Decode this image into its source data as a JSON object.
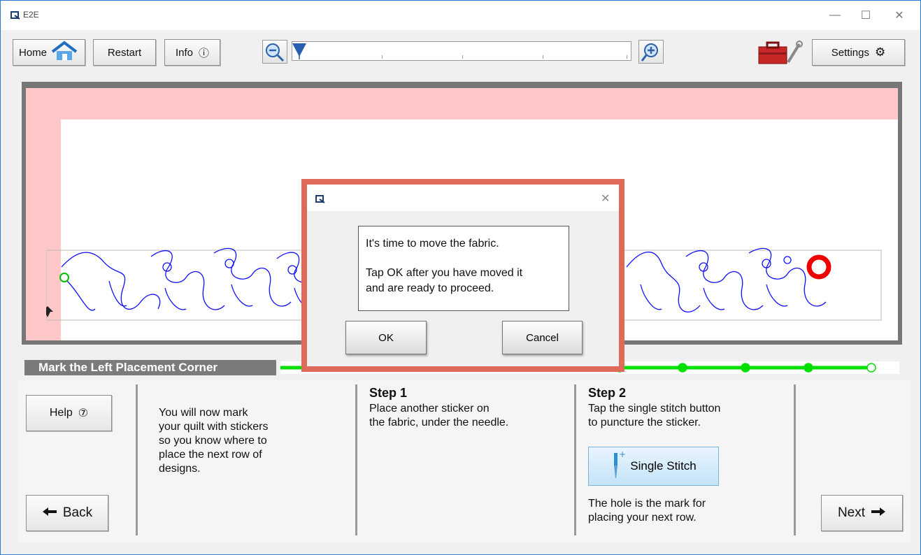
{
  "window": {
    "title": "E2E",
    "minimize": "—",
    "maximize": "☐",
    "close": "✕"
  },
  "toolbar": {
    "home_label": "Home",
    "restart_label": "Restart",
    "info_label": "Info",
    "info_icon": "ⓘ",
    "settings_label": "Settings",
    "settings_icon": "⚙"
  },
  "zoom": {
    "level": 0.0
  },
  "progress": {
    "label": "Mark the Left Placement Corner",
    "steps_total": 5,
    "steps_completed": 5
  },
  "help_label": "Help",
  "help_icon": "⑦",
  "back_label": "Back",
  "next_label": "Next",
  "intro_text": [
    "You will now mark",
    "your quilt with stickers",
    "so you know where to",
    "place the next row of",
    "designs."
  ],
  "step1": {
    "title": "Step 1",
    "lines": [
      "Place another sticker on",
      "the fabric, under the needle."
    ]
  },
  "step2": {
    "title": "Step 2",
    "lines": [
      "Tap the single stitch button",
      "to puncture the sticker."
    ],
    "button_label": "Single Stitch",
    "after_lines": [
      "The hole is the mark for",
      "placing your next row."
    ]
  },
  "dialog": {
    "close": "✕",
    "line1": "It's time to move the fabric.",
    "line2": "Tap OK after you have moved it",
    "line3": "and are ready to proceed.",
    "ok_label": "OK",
    "cancel_label": "Cancel"
  },
  "colors": {
    "accent_red": "#e06a5a",
    "pink": "#ffc7c7",
    "green": "#00e000",
    "design_blue": "#1010ff"
  }
}
